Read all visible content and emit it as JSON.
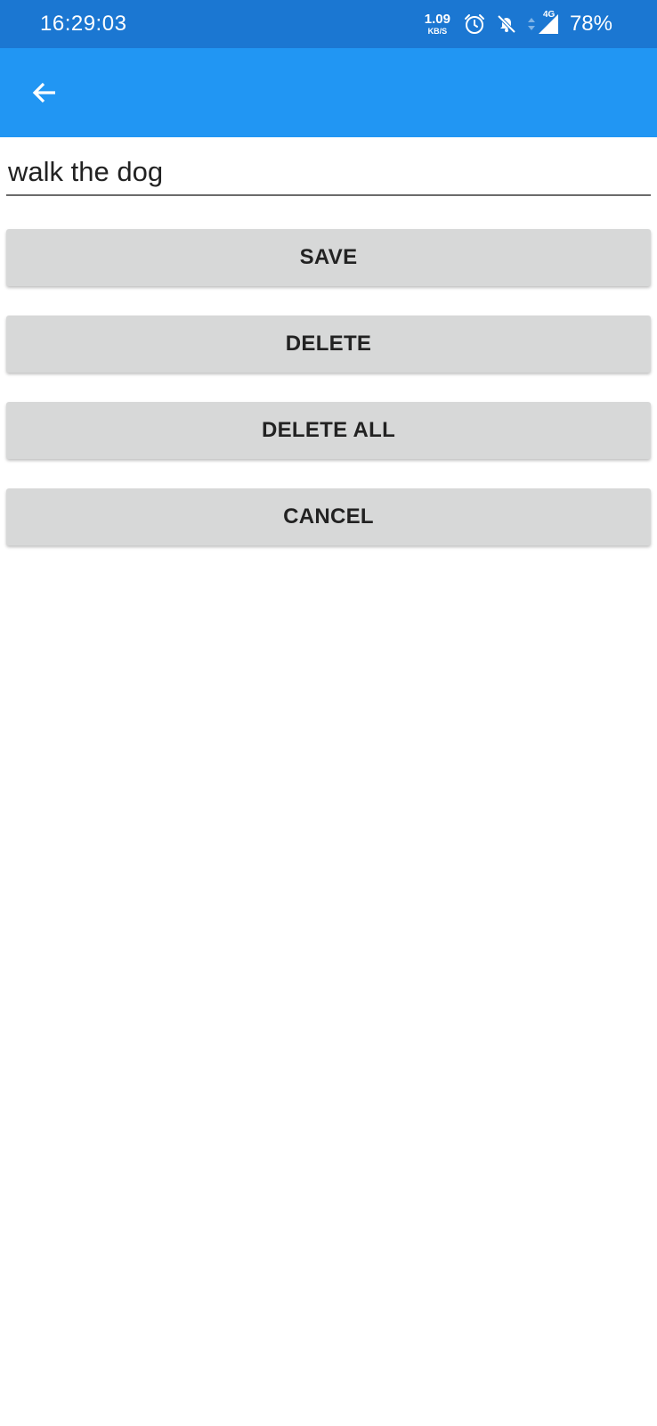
{
  "status_bar": {
    "time": "16:29:03",
    "net_speed_value": "1.09",
    "net_speed_unit": "KB/S",
    "network_type": "4G",
    "battery": "78%",
    "icons": [
      "alarm-icon",
      "bell-off-icon",
      "signal-icon"
    ],
    "background_color": "#1b77d2"
  },
  "app_bar": {
    "background_color": "#2196f3",
    "back_icon": "arrow-left-icon"
  },
  "task_field": {
    "value": "walk the dog"
  },
  "buttons": {
    "save": "SAVE",
    "delete": "DELETE",
    "delete_all": "DELETE ALL",
    "cancel": "CANCEL"
  },
  "colors": {
    "button_background": "#d7d8d8",
    "button_text": "#222222"
  }
}
